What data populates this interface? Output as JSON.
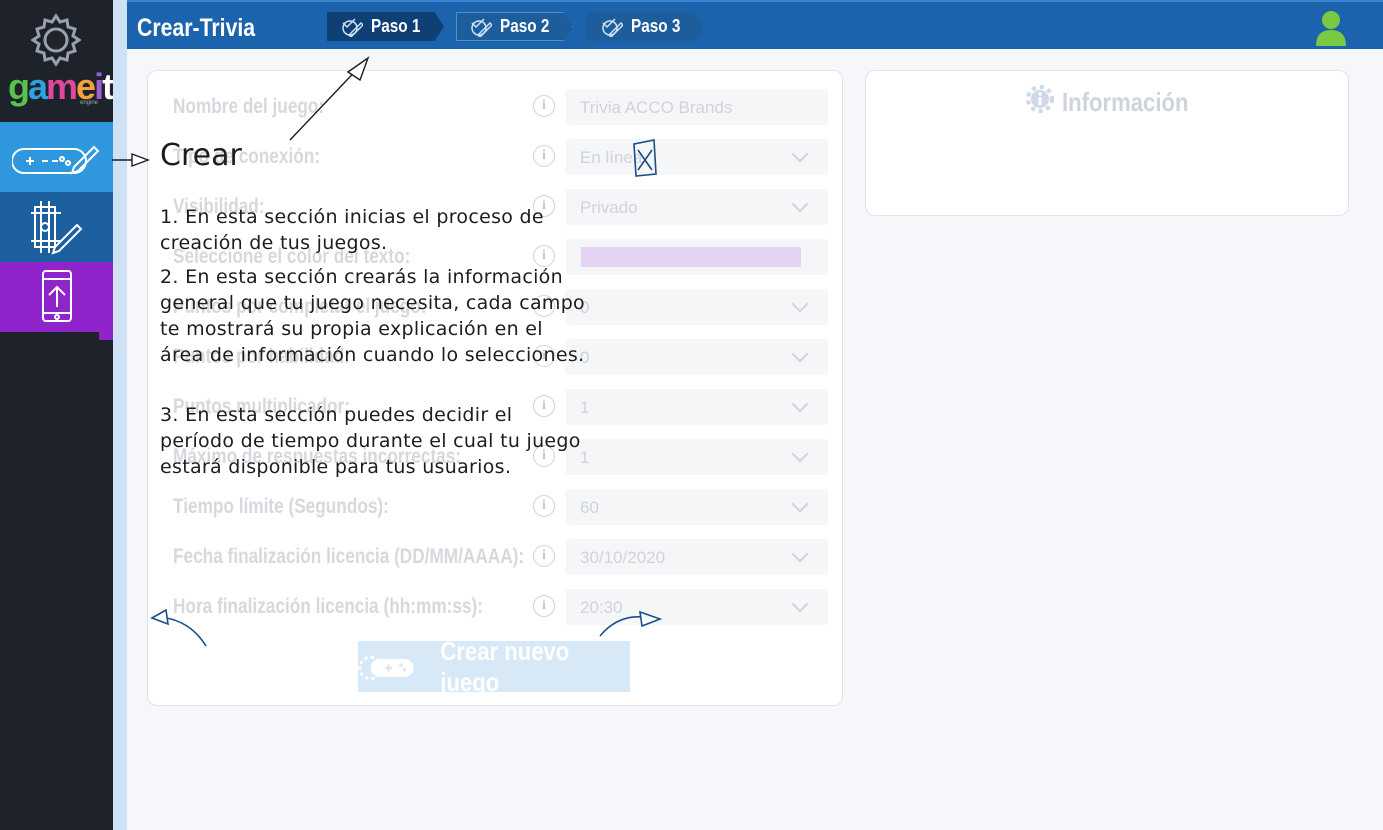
{
  "brand": {
    "logo_text": "gameit",
    "sub_text": "engine"
  },
  "app": {
    "title": "Crear-Trivia"
  },
  "steps": [
    {
      "label": "Paso 1",
      "active": true
    },
    {
      "label": "Paso 2",
      "active": false
    },
    {
      "label": "Paso 3",
      "active": false
    }
  ],
  "sidebar": {
    "items": [
      {
        "name": "create",
        "icon": "gamepad-pencil-icon",
        "color": "#2f97dd"
      },
      {
        "name": "design",
        "icon": "design-tools-icon",
        "color": "#1b5f9f"
      },
      {
        "name": "publish",
        "icon": "phone-upload-icon",
        "color": "#8e24c9"
      }
    ]
  },
  "form": {
    "fields": [
      {
        "label": "Nombre del juego:",
        "value": "Trivia ACCO Brands",
        "type": "text"
      },
      {
        "label": "Tipo de conexión:",
        "value": "En línea",
        "type": "select"
      },
      {
        "label": "Visibilidad:",
        "value": "Privado",
        "type": "select"
      },
      {
        "label": "Seleccione el color del texto:",
        "value": "",
        "type": "color",
        "color": "#e4d3f2"
      },
      {
        "label": "Puntos por completar el juego:",
        "value": "0",
        "type": "select"
      },
      {
        "label": "Puntos por habilidad:",
        "value": "0",
        "type": "select"
      },
      {
        "label": "Puntos multiplicador:",
        "value": "1",
        "type": "select"
      },
      {
        "label": "Máximo de respuestas incorrectas:",
        "value": "1",
        "type": "select"
      },
      {
        "label": "Tiempo límite (Segundos):",
        "value": "60",
        "type": "select"
      },
      {
        "label": "Fecha finalización licencia (DD/MM/AAAA):",
        "value": "30/10/2020",
        "type": "select"
      },
      {
        "label": "Hora finalización licencia (hh:mm:ss):",
        "value": "20:30",
        "type": "select"
      }
    ],
    "submit_label": "Crear nuevo juego"
  },
  "info_panel": {
    "title": "Información"
  },
  "overlay": {
    "heading": "Crear",
    "p1": "1. En esta sección inicias el proceso de creación de tus juegos.",
    "p2": "2. En esta sección crearás la información general que tu juego necesita, cada campo te mostrará su propia explicación en el área de información cuando lo selecciones.",
    "p3": "3. En esta sección puedes decidir el período de tiempo durante el cual tu juego estará disponible para tus usuarios."
  },
  "colors": {
    "topbar": "#1b63ac",
    "step_active": "#0e3f75",
    "sidebar": "#1d222b",
    "user": "#7ac943"
  }
}
